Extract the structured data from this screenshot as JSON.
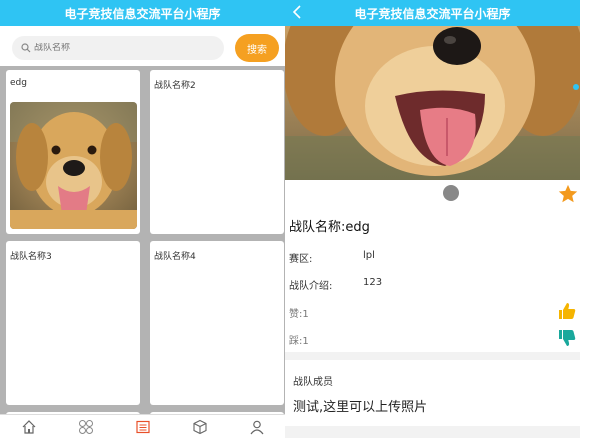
{
  "left": {
    "title": "电子竞技信息交流平台小程序",
    "search": {
      "placeholder": "战队名称",
      "button": "搜索"
    },
    "cards": [
      {
        "label": "edg",
        "has_photo": true
      },
      {
        "label": "战队名称2"
      },
      {
        "label": "战队名称3"
      },
      {
        "label": "战队名称4"
      }
    ],
    "tabs": [
      "home-icon",
      "grid-icon",
      "list-icon",
      "cube-icon",
      "user-icon"
    ]
  },
  "right": {
    "title": "电子竞技信息交流平台小程序",
    "team": {
      "label": "战队名称:",
      "value": "edg"
    },
    "region": {
      "label": "赛区:",
      "value": "lpl"
    },
    "intro": {
      "label": "战队介绍:",
      "value": "123"
    },
    "likes": {
      "label": "赞:",
      "value": "1"
    },
    "dislikes": {
      "label": "踩:",
      "value": "1"
    },
    "members": {
      "title": "战队成员",
      "text": "测试,这里可以上传照片"
    }
  },
  "colors": {
    "accent": "#2fc4f3",
    "search_button": "#f5a021",
    "star": "#f39a1e",
    "like": "#f5b400",
    "dislike": "#1aa89c"
  }
}
